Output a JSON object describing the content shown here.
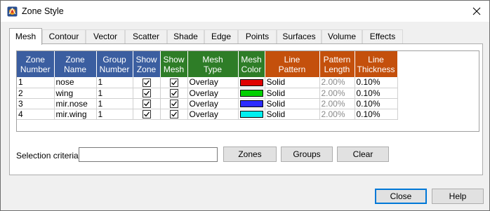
{
  "window": {
    "title": "Zone Style"
  },
  "tabs": [
    {
      "label": "Mesh",
      "active": true
    },
    {
      "label": "Contour"
    },
    {
      "label": "Vector"
    },
    {
      "label": "Scatter"
    },
    {
      "label": "Shade"
    },
    {
      "label": "Edge"
    },
    {
      "label": "Points"
    },
    {
      "label": "Surfaces"
    },
    {
      "label": "Volume"
    },
    {
      "label": "Effects"
    }
  ],
  "grid": {
    "headers": [
      {
        "line1": "Zone",
        "line2": "Number",
        "group": "blue"
      },
      {
        "line1": "Zone",
        "line2": "Name",
        "group": "blue"
      },
      {
        "line1": "Group",
        "line2": "Number",
        "group": "blue"
      },
      {
        "line1": "Show",
        "line2": "Zone",
        "group": "blue"
      },
      {
        "line1": "Show",
        "line2": "Mesh",
        "group": "green"
      },
      {
        "line1": "Mesh",
        "line2": "Type",
        "group": "green"
      },
      {
        "line1": "Mesh",
        "line2": "Color",
        "group": "green"
      },
      {
        "line1": "Line",
        "line2": "Pattern",
        "group": "orange"
      },
      {
        "line1": "Pattern",
        "line2": "Length",
        "group": "orange"
      },
      {
        "line1": "Line",
        "line2": "Thickness",
        "group": "orange"
      }
    ],
    "rows": [
      {
        "number": "1",
        "name": "nose",
        "group": "1",
        "show_zone": true,
        "show_mesh": true,
        "mesh_type": "Overlay",
        "mesh_color": "#e00000",
        "line_pattern": "Solid",
        "pattern_length": "2.00%",
        "line_thickness": "0.10%"
      },
      {
        "number": "2",
        "name": "wing",
        "group": "1",
        "show_zone": true,
        "show_mesh": true,
        "mesh_type": "Overlay",
        "mesh_color": "#00d000",
        "line_pattern": "Solid",
        "pattern_length": "2.00%",
        "line_thickness": "0.10%"
      },
      {
        "number": "3",
        "name": "mir.nose",
        "group": "1",
        "show_zone": true,
        "show_mesh": true,
        "mesh_type": "Overlay",
        "mesh_color": "#2b2bff",
        "line_pattern": "Solid",
        "pattern_length": "2.00%",
        "line_thickness": "0.10%"
      },
      {
        "number": "4",
        "name": "mir.wing",
        "group": "1",
        "show_zone": true,
        "show_mesh": true,
        "mesh_type": "Overlay",
        "mesh_color": "#00f0f0",
        "line_pattern": "Solid",
        "pattern_length": "2.00%",
        "line_thickness": "0.10%"
      }
    ]
  },
  "selection": {
    "label": "Selection criteria:",
    "value": "",
    "zones_button": "Zones",
    "groups_button": "Groups",
    "clear_button": "Clear"
  },
  "footer": {
    "close_button": "Close",
    "help_button": "Help"
  },
  "icons": {
    "app": "tecplot-logo-icon",
    "close": "close-icon",
    "check": "check-icon"
  }
}
